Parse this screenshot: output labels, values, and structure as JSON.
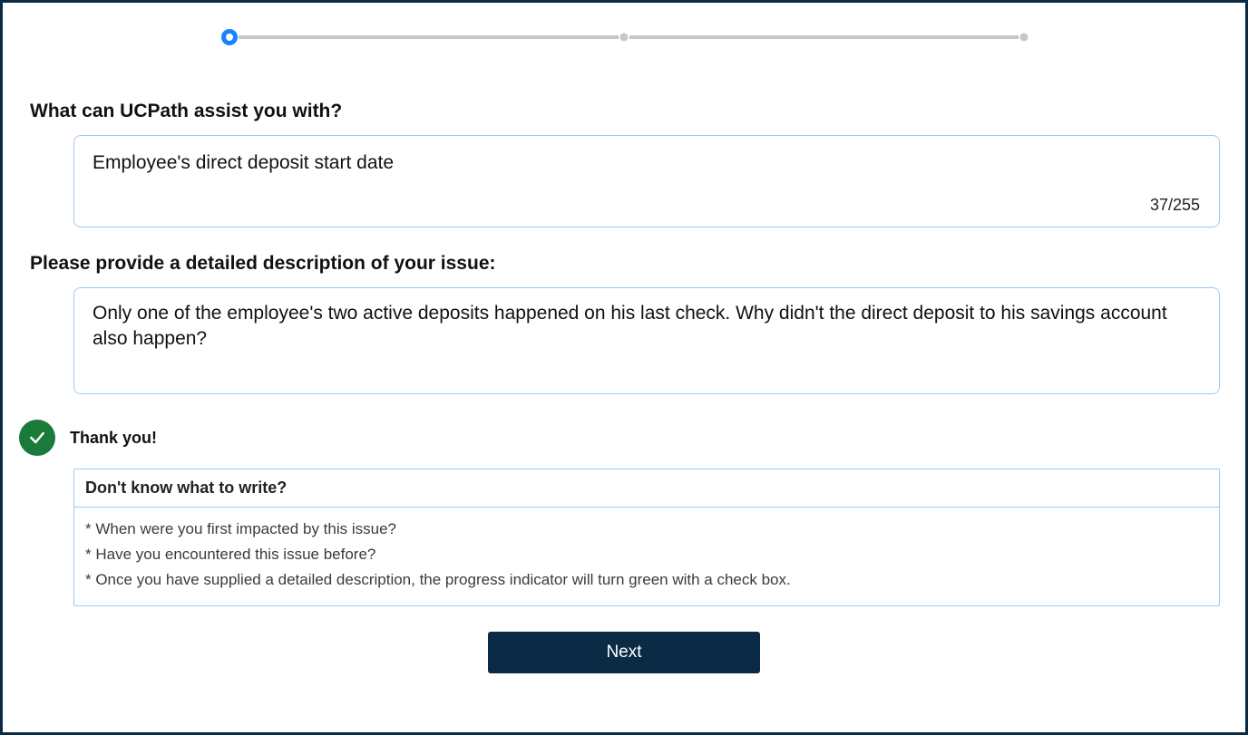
{
  "progress": {
    "steps_total": 3,
    "current_step": 1
  },
  "subject": {
    "label": "What can UCPath assist you with?",
    "value": "Employee's direct deposit start date",
    "char_counter": "37/255"
  },
  "description": {
    "label": "Please provide a detailed description of your issue:",
    "value": "Only one of the employee's two active deposits happened on his last check. Why didn't the direct deposit to his savings account also happen?"
  },
  "status": {
    "thank_you": "Thank you!"
  },
  "hints": {
    "header": "Don't know what to write?",
    "lines": [
      "* When were you first impacted by this issue?",
      "* Have you encountered this issue before?",
      "* Once you have supplied a detailed description, the progress indicator will turn green with a check box."
    ]
  },
  "buttons": {
    "next": "Next"
  }
}
